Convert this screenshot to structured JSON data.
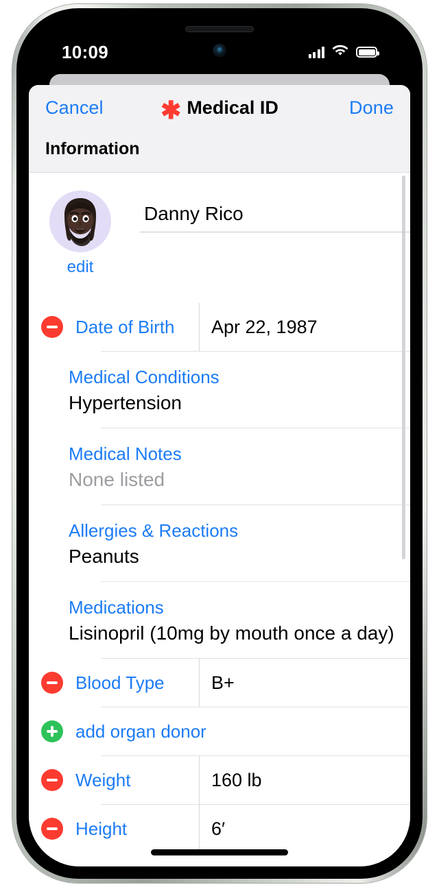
{
  "status_bar": {
    "time": "10:09",
    "cellular_icon": "cellular-bars-icon",
    "wifi_icon": "wifi-icon",
    "battery_icon": "battery-full-icon"
  },
  "nav_bar": {
    "cancel_label": "Cancel",
    "title": "Medical ID",
    "title_icon": "medical-asterisk-icon",
    "done_label": "Done"
  },
  "section": {
    "header": "Information"
  },
  "identity": {
    "avatar_icon": "memoji-avatar",
    "edit_label": "edit",
    "name_value": "Danny Rico",
    "name_placeholder": "Name"
  },
  "fields": {
    "date_of_birth": {
      "label": "Date of Birth",
      "value": "Apr 22, 1987",
      "remove_icon": "minus-circle-icon"
    },
    "medical_conditions": {
      "label": "Medical Conditions",
      "value": "Hypertension",
      "is_placeholder": false
    },
    "medical_notes": {
      "label": "Medical Notes",
      "value": "None listed",
      "is_placeholder": true
    },
    "allergies": {
      "label": "Allergies & Reactions",
      "value": "Peanuts",
      "is_placeholder": false
    },
    "medications": {
      "label": "Medications",
      "value": "Lisinopril (10mg by mouth once a day)",
      "is_placeholder": false
    },
    "blood_type": {
      "label": "Blood Type",
      "value": "B+",
      "remove_icon": "minus-circle-icon"
    },
    "organ_donor": {
      "label": "add organ donor",
      "add_icon": "plus-circle-icon"
    },
    "weight": {
      "label": "Weight",
      "value": "160 lb",
      "remove_icon": "minus-circle-icon"
    },
    "height": {
      "label": "Height",
      "value": "6′",
      "remove_icon": "minus-circle-icon"
    }
  },
  "colors": {
    "accent_blue": "#1c7cf5",
    "destructive_red": "#fc3b30",
    "add_green": "#2ec25a",
    "medical_red": "#ff3b30",
    "chrome_gray": "#f2f2f5"
  }
}
